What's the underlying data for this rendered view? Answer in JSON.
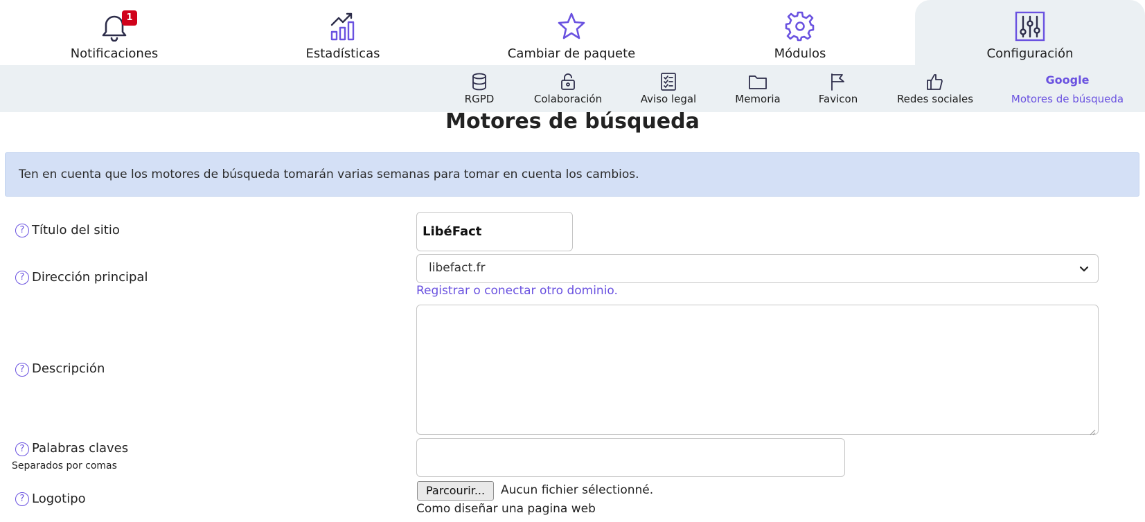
{
  "topnav": {
    "items": [
      {
        "label": "Notificaciones",
        "icon": "bell-icon",
        "badge": "1"
      },
      {
        "label": "Estadísticas",
        "icon": "chart-icon"
      },
      {
        "label": "Cambiar de paquete",
        "icon": "star-icon"
      },
      {
        "label": "Módulos",
        "icon": "gear-icon"
      },
      {
        "label": "Configuración",
        "icon": "sliders-icon",
        "active": true
      }
    ]
  },
  "subnav": {
    "items": [
      {
        "label": "RGPD",
        "icon": "database-icon"
      },
      {
        "label": "Colaboración",
        "icon": "lock-icon"
      },
      {
        "label": "Aviso legal",
        "icon": "checklist-icon"
      },
      {
        "label": "Memoria",
        "icon": "folder-icon"
      },
      {
        "label": "Favicon",
        "icon": "flag-icon"
      },
      {
        "label": "Redes sociales",
        "icon": "thumbs-up-icon"
      },
      {
        "label": "Motores de búsqueda",
        "icon_text": "Google",
        "active": true
      }
    ]
  },
  "page": {
    "title": "Motores de búsqueda",
    "notice": "Ten en cuenta que los motores de búsqueda tomarán varias semanas para tomar en cuenta los cambios."
  },
  "form": {
    "help_symbol": "?",
    "site_title": {
      "label": "Título del sitio",
      "value": "LibéFact"
    },
    "main_address": {
      "label": "Dirección principal",
      "value": "libefact.fr",
      "link": "Registrar o conectar otro dominio."
    },
    "description": {
      "label": "Descripción",
      "value": ""
    },
    "keywords": {
      "label": "Palabras claves",
      "sublabel": "Separados por comas",
      "value": ""
    },
    "logo": {
      "label": "Logotipo",
      "button": "Parcourir...",
      "status": "Aucun fichier sélectionné.",
      "helper": "Como diseñar una pagina web"
    }
  },
  "colors": {
    "accent": "#6a52e0",
    "nav_bg": "#ebf0f3",
    "notice_bg": "#d4e0f6",
    "badge": "#d0021b"
  }
}
